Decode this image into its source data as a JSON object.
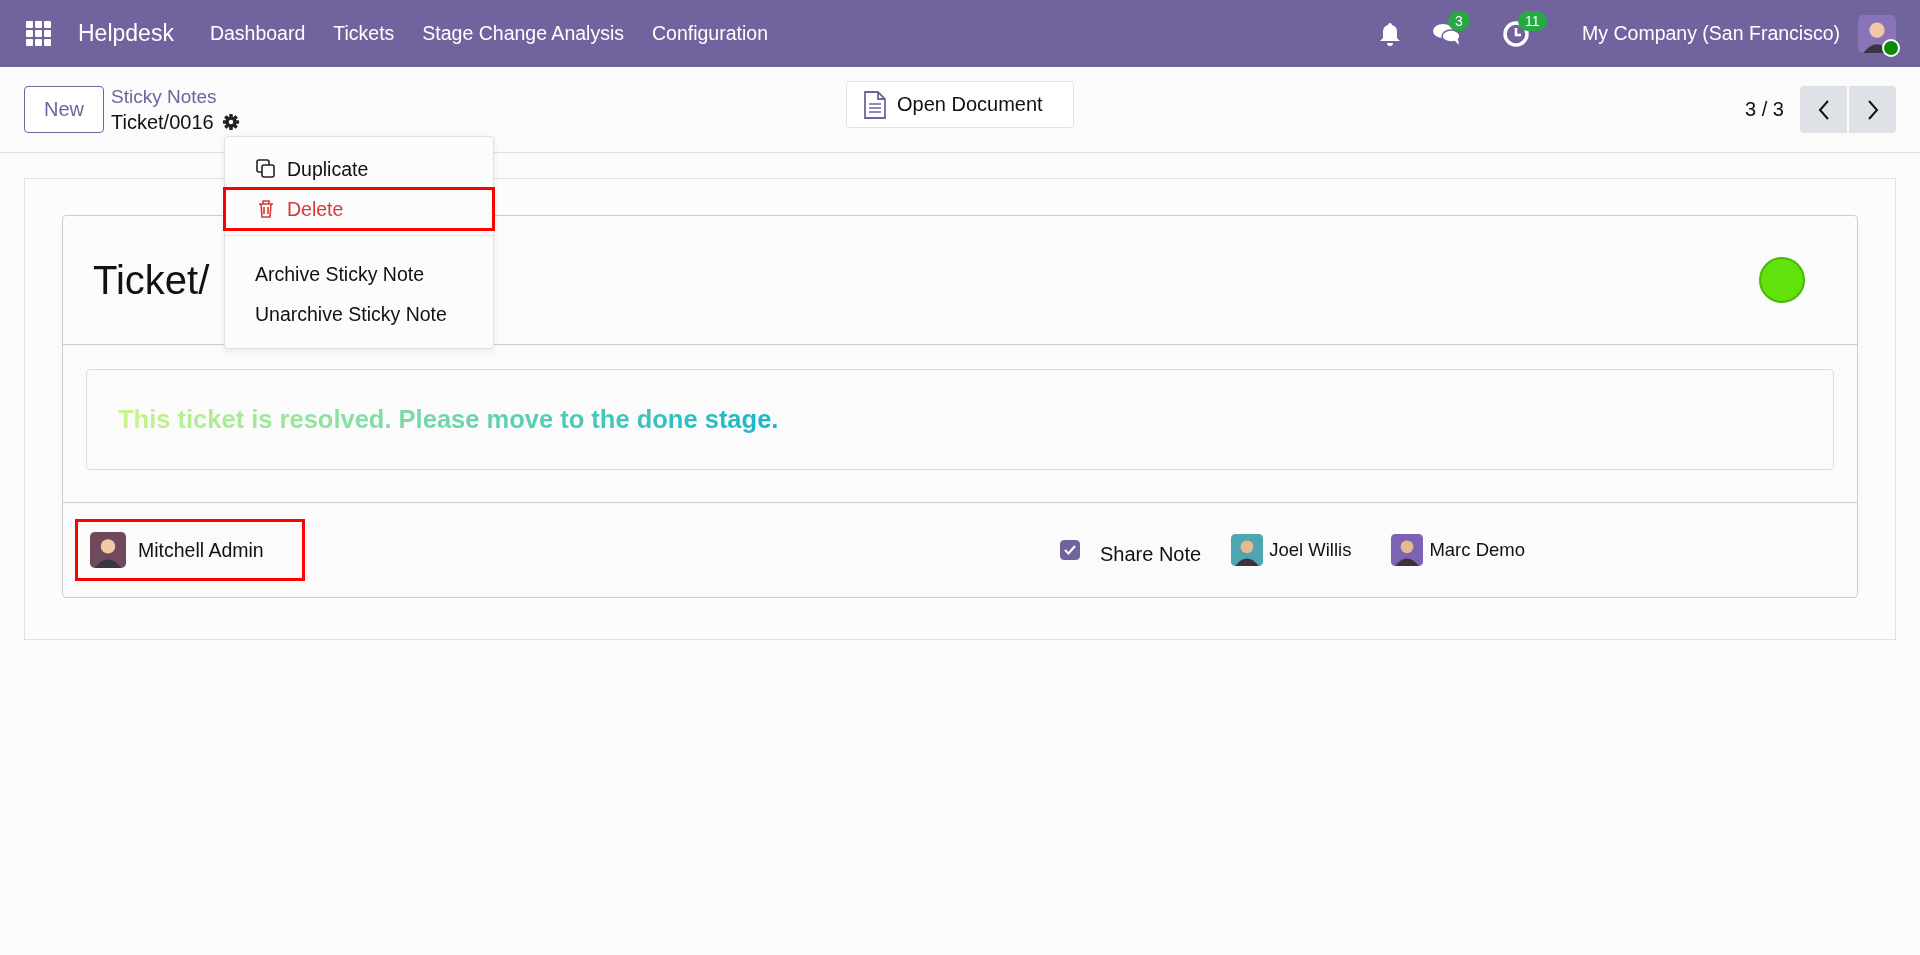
{
  "navbar": {
    "app_name": "Helpdesk",
    "menu": [
      {
        "label": "Dashboard"
      },
      {
        "label": "Tickets"
      },
      {
        "label": "Stage Change Analysis"
      },
      {
        "label": "Configuration"
      }
    ],
    "messages_badge": "3",
    "activities_badge": "11",
    "company": "My Company (San Francisco)"
  },
  "control_panel": {
    "new_button": "New",
    "breadcrumb": "Sticky Notes",
    "record": "Ticket/0016",
    "open_document": "Open Document",
    "pager": "3 / 3"
  },
  "action_menu": {
    "items": [
      {
        "label": "Duplicate",
        "kind": "duplicate",
        "highlighted": false
      },
      {
        "label": "Delete",
        "kind": "delete",
        "highlighted": true
      },
      {
        "kind": "divider"
      },
      {
        "label": "Archive Sticky Note",
        "kind": "plain",
        "highlighted": false
      },
      {
        "label": "Unarchive Sticky Note",
        "kind": "plain",
        "highlighted": false
      }
    ]
  },
  "note": {
    "title": "Ticket/",
    "message": "This ticket is resolved. Please move to the done stage.",
    "owner": {
      "name": "Mitchell Admin",
      "highlighted": true
    },
    "share_note": {
      "label": "Share Note",
      "checked": true
    },
    "followers": [
      {
        "name": "Joel Willis",
        "color": "#4fa6b0"
      },
      {
        "name": "Marc Demo",
        "color": "#7d63b3"
      }
    ]
  }
}
